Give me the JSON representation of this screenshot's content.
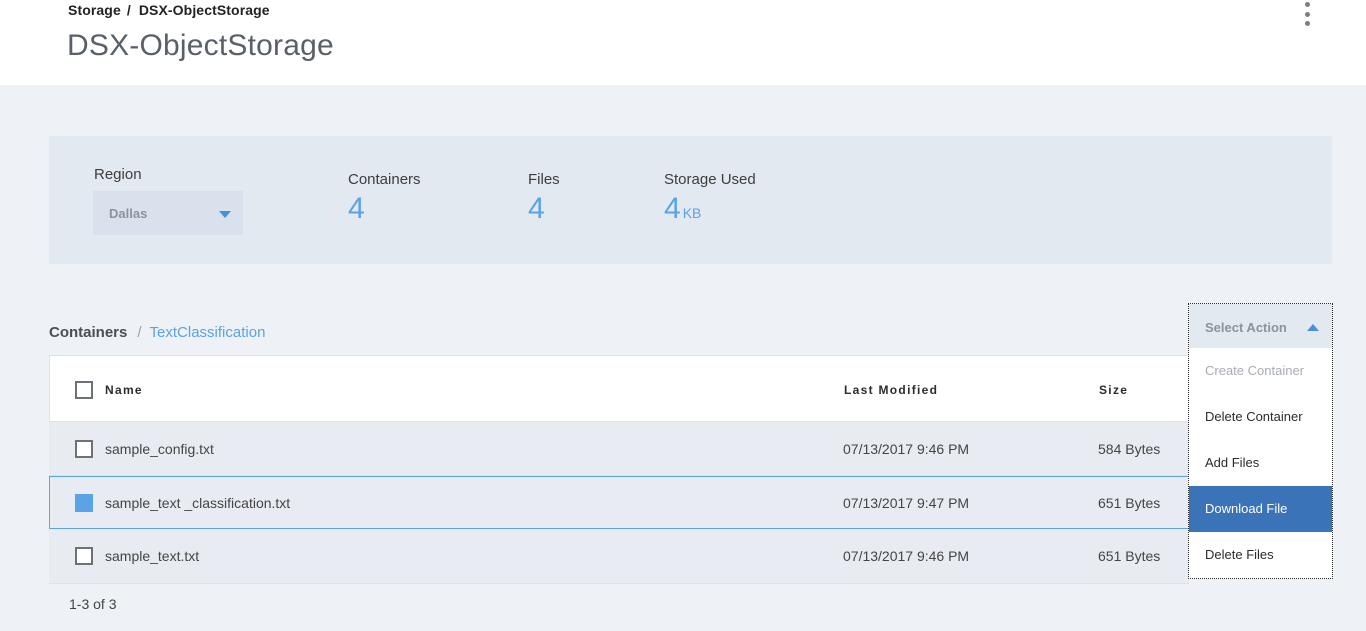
{
  "header": {
    "breadcrumb": {
      "root": "Storage",
      "separator": "/",
      "current": "DSX-ObjectStorage"
    },
    "title": "DSX-ObjectStorage",
    "more_icon": "kebab-vertical-icon"
  },
  "stats": {
    "region": {
      "label": "Region",
      "value": "Dallas"
    },
    "containers": {
      "label": "Containers",
      "value": "4"
    },
    "files": {
      "label": "Files",
      "value": "4"
    },
    "storage_used": {
      "label": "Storage Used",
      "value": "4",
      "unit": "KB"
    }
  },
  "container_breadcrumb": {
    "root": "Containers",
    "separator": "/",
    "current": "TextClassification"
  },
  "table": {
    "columns": {
      "name": "Name",
      "last_modified": "Last Modified",
      "size": "Size"
    },
    "rows": [
      {
        "name": "sample_config.txt",
        "modified": "07/13/2017 9:46 PM",
        "size": "584 Bytes",
        "checked": false
      },
      {
        "name": "sample_text _classification.txt",
        "modified": "07/13/2017 9:47 PM",
        "size": "651 Bytes",
        "checked": true
      },
      {
        "name": "sample_text.txt",
        "modified": "07/13/2017 9:46 PM",
        "size": "651 Bytes",
        "checked": false
      }
    ]
  },
  "action_menu": {
    "placeholder": "Select Action",
    "items": [
      {
        "label": "Create Container",
        "state": "disabled"
      },
      {
        "label": "Delete Container",
        "state": "normal"
      },
      {
        "label": "Add Files",
        "state": "normal"
      },
      {
        "label": "Download File",
        "state": "highlighted"
      },
      {
        "label": "Delete Files",
        "state": "normal"
      }
    ]
  },
  "pagination": {
    "text": "1-3 of 3"
  },
  "colors": {
    "accent": "#5aa3e6",
    "menu_highlight": "#3b73b9",
    "panel": "#e3e9f1"
  }
}
